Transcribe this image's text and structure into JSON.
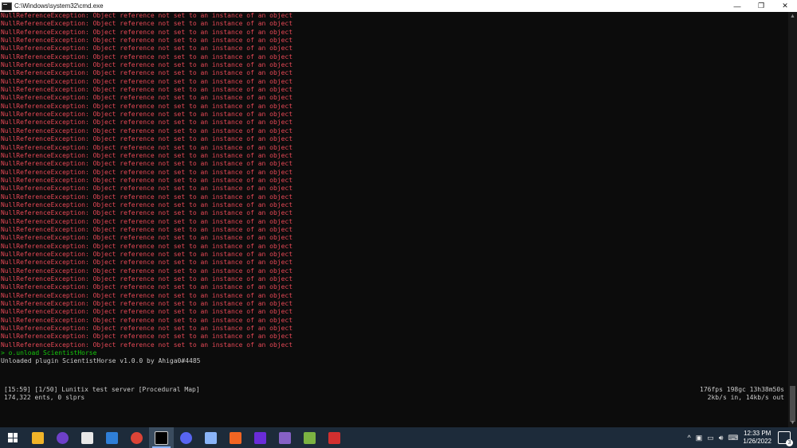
{
  "window": {
    "title": "C:\\Windows\\system32\\cmd.exe",
    "minimize_glyph": "—",
    "maximize_glyph": "❐",
    "close_glyph": "✕"
  },
  "console": {
    "error_line": "NullReferenceException: Object reference not set to an instance of an object",
    "error_count": 41,
    "command_line": "> o.unload ScientistHorse",
    "output_line": "Unloaded plugin ScientistHorse v1.0.0 by Ahiga0#4485"
  },
  "status": {
    "left_line1": "[15:59] [1/50] Lunitix test server [Procedural Map]",
    "left_line2": "174,322 ents, 0 slprs",
    "right_line1": "176fps 198gc 13h38m50s",
    "right_line2": "2kb/s in, 14kb/s out"
  },
  "taskbar": {
    "apps": [
      {
        "name": "file-explorer-icon",
        "color": "#f0b429"
      },
      {
        "name": "github-desktop-icon",
        "color": "#6e40c9"
      },
      {
        "name": "store-icon",
        "color": "#e8e8e8"
      },
      {
        "name": "mail-icon",
        "color": "#2f7fd8"
      },
      {
        "name": "chrome-icon",
        "color": "#db4437"
      },
      {
        "name": "terminal-icon",
        "color": "#000000"
      },
      {
        "name": "browser-icon",
        "color": "#5865f2"
      },
      {
        "name": "tool-icon",
        "color": "#8ab4f8"
      },
      {
        "name": "settings-app-icon",
        "color": "#f26522"
      },
      {
        "name": "app-icon",
        "color": "#6a2cd9"
      },
      {
        "name": "visual-studio-icon",
        "color": "#8661c5"
      },
      {
        "name": "editor-icon",
        "color": "#7cb342"
      },
      {
        "name": "red-app-icon",
        "color": "#d32f2f"
      }
    ],
    "clock_time": "12:33 PM",
    "clock_date": "1/26/2022",
    "notification_count": "3"
  }
}
